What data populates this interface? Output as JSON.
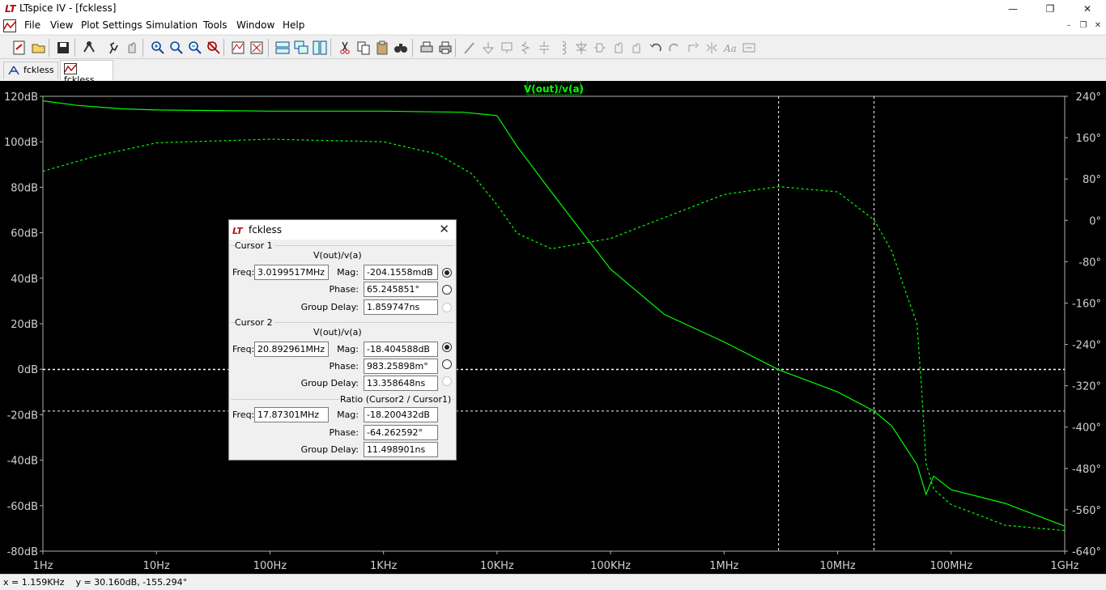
{
  "window": {
    "title": "LTspice IV - [fckless]",
    "controls": {
      "minimize": "—",
      "maximize": "❐",
      "close": "✕"
    },
    "mdi_controls": {
      "minimize": "–",
      "restore": "❐",
      "close": "✕"
    }
  },
  "menu": {
    "file": "File",
    "view": "View",
    "plot_settings": "Plot Settings",
    "simulation": "Simulation",
    "tools": "Tools",
    "window": "Window",
    "help": "Help"
  },
  "toolbar": {
    "icons": [
      "new-schematic-icon",
      "open-icon",
      "save-icon",
      "control-panel-icon",
      "run-icon",
      "halt-icon",
      "zoom-in-icon",
      "zoom-full-icon",
      "zoom-out-icon",
      "autorange-icon",
      "pick-traces-icon",
      "delete-trace-icon",
      "tile-horizontal-icon",
      "cascade-icon",
      "tile-vertical-icon",
      "cut-icon",
      "copy-icon",
      "paste-icon",
      "find-icon",
      "print-preview-icon",
      "print-icon",
      "wire-icon",
      "ground-icon",
      "label-net-icon",
      "resistor-icon",
      "capacitor-icon",
      "inductor-icon",
      "diode-icon",
      "component-icon",
      "move-icon",
      "drag-icon",
      "undo-icon",
      "redo-icon",
      "rotate-icon",
      "mirror-icon",
      "text-icon",
      "spice-directive-icon"
    ]
  },
  "tabs": [
    {
      "label": "fckless",
      "icon": "schematic-icon",
      "active": false
    },
    {
      "label": "fckless",
      "icon": "waveform-icon",
      "active": true
    }
  ],
  "plot": {
    "trace_label": "V(out)/v(a)",
    "trace_color": "#00ff00",
    "background": "#000000",
    "left_ticks": [
      "120dB",
      "100dB",
      "80dB",
      "60dB",
      "40dB",
      "20dB",
      "0dB",
      "-20dB",
      "-40dB",
      "-60dB",
      "-80dB"
    ],
    "right_ticks": [
      "240°",
      "160°",
      "80°",
      "0°",
      "-80°",
      "-160°",
      "-240°",
      "-320°",
      "-400°",
      "-480°",
      "-560°",
      "-640°"
    ],
    "x_ticks": [
      "1Hz",
      "10Hz",
      "100Hz",
      "1KHz",
      "10KHz",
      "100KHz",
      "1MHz",
      "10MHz",
      "100MHz",
      "1GHz"
    ]
  },
  "chart_data": {
    "type": "line",
    "x_scale": "log",
    "xlim": [
      1,
      1000000000
    ],
    "ylim": [
      -80,
      120
    ],
    "y2lim": [
      -640,
      240
    ],
    "grid": false,
    "series": [
      {
        "name": "V(out)/v(a)",
        "kind": "magnitude_dB",
        "style": "solid",
        "x": [
          1,
          2,
          5,
          10,
          100,
          1000,
          5000,
          8000,
          10000,
          15000,
          30000,
          100000,
          300000,
          1000000,
          3019951.7,
          10000000,
          20892961,
          30000000,
          50000000,
          60000000,
          70000000,
          100000000,
          300000000,
          1000000000
        ],
        "y": [
          118,
          116,
          114.5,
          114,
          113.5,
          113.5,
          113,
          112,
          111.5,
          98,
          78,
          44,
          24,
          12,
          -0.2,
          -10,
          -18.4,
          -25,
          -42,
          -55,
          -47,
          -53,
          -59,
          -69
        ]
      },
      {
        "name": "V(out)/v(a) phase",
        "kind": "phase_deg",
        "style": "dashed",
        "x": [
          1,
          3,
          10,
          100,
          1000,
          3000,
          6000,
          10000,
          15000,
          30000,
          100000,
          1000000,
          3019951.7,
          10000000,
          20892961,
          30000000,
          40000000,
          50000000,
          55000000,
          60000000,
          70000000,
          100000000,
          300000000,
          1000000000
        ],
        "y": [
          95,
          125,
          150,
          157,
          152,
          128,
          90,
          30,
          -25,
          -55,
          -35,
          50,
          65.2,
          55,
          1,
          -60,
          -140,
          -200,
          -330,
          -470,
          -520,
          -550,
          -590,
          -600
        ]
      }
    ],
    "cursors": [
      {
        "x": 3019951.7
      },
      {
        "x": 20892961
      }
    ]
  },
  "dialog": {
    "title": "fckless",
    "cursor1": {
      "group": "Cursor 1",
      "trace": "V(out)/v(a)",
      "freq_label": "Freq:",
      "freq": "3.0199517MHz",
      "mag_label": "Mag:",
      "mag": "-204.1558mdB",
      "phase_label": "Phase:",
      "phase": "65.245851°",
      "gd_label": "Group Delay:",
      "gd": "1.859747ns"
    },
    "cursor2": {
      "group": "Cursor 2",
      "trace": "V(out)/v(a)",
      "freq_label": "Freq:",
      "freq": "20.892961MHz",
      "mag_label": "Mag:",
      "mag": "-18.404588dB",
      "phase_label": "Phase:",
      "phase": "983.25898m°",
      "gd_label": "Group Delay:",
      "gd": "13.358648ns"
    },
    "ratio": {
      "group": "Ratio (Cursor2 / Cursor1)",
      "freq_label": "Freq:",
      "freq": "17.87301MHz",
      "mag_label": "Mag:",
      "mag": "-18.200432dB",
      "phase_label": "Phase:",
      "phase": "-64.262592°",
      "gd_label": "Group Delay:",
      "gd": "11.498901ns"
    }
  },
  "status": {
    "text": "x = 1.159KHz    y = 30.160dB, -155.294°"
  }
}
